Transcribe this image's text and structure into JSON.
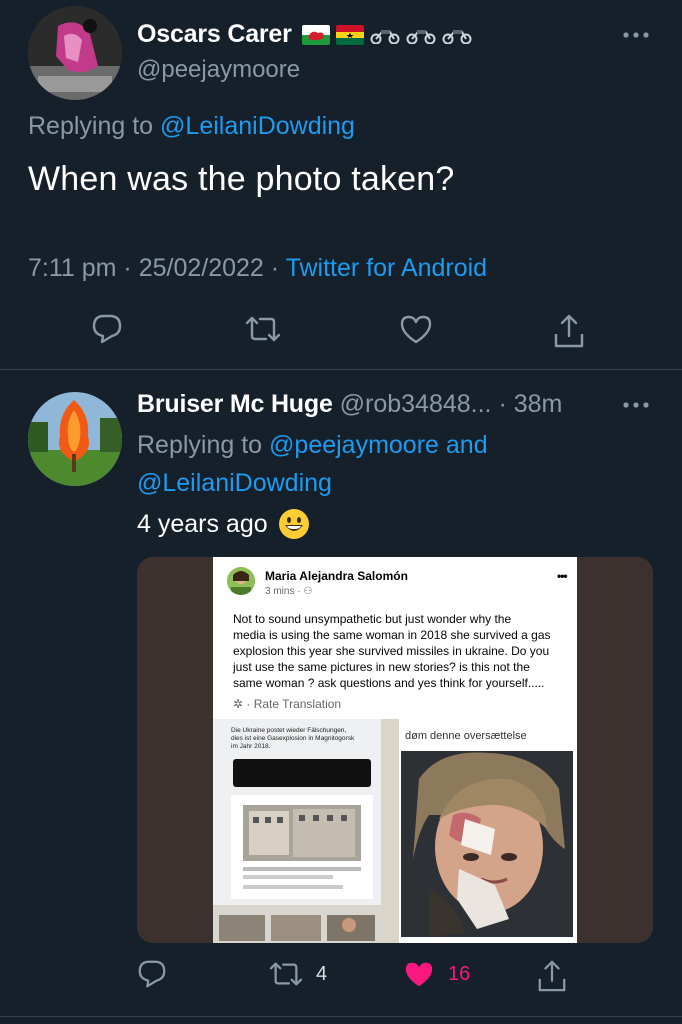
{
  "main_tweet": {
    "display_name": "Oscars Carer",
    "handle": "@peejaymoore",
    "replying_prefix": "Replying to",
    "replying_to": "@LeilaniDowding",
    "text": "When was the photo taken?",
    "time": "7:11 pm · 25/02/2022 ·",
    "source": "Twitter for Android",
    "icons": [
      "wales-flag-icon",
      "ghana-flag-icon",
      "motorcycle-icon",
      "motorcycle-icon",
      "motorcycle-icon"
    ]
  },
  "reply_tweet": {
    "display_name": "Bruiser Mc Huge",
    "handle_time": "@rob34848... · 38m",
    "replying_prefix": "Replying to",
    "replying_to_1": "@peejaymoore",
    "replying_and": "and",
    "replying_to_2": "@LeilaniDowding",
    "text": "4 years ago",
    "retweet_count": "4",
    "like_count": "16",
    "media": {
      "fb_name": "Maria Alejandra Salomón",
      "fb_time": "3 mins · ⚇",
      "fb_more": "•••",
      "fb_text": "Not to sound unsympathetic but just wonder why the\nmedia is using the same woman in 2018 she survived a gas\nexplosion this year she survived missiles in ukraine. Do you\njust use the same pictures in new stories? is this not the\nsame woman ? ask questions and yes think for yourself.....",
      "fb_rate": "✲ · Rate Translation",
      "left_caption": "Die Ukraine postet wieder Fälschungen,\ndies ist eine Gasexplosion in Magnitogorsk\nim Jahr 2018.",
      "right_caption": "døm denne oversættelse"
    }
  },
  "colors": {
    "background": "#15202b",
    "accent": "#1d9bf0",
    "muted": "#8b98a5",
    "like": "#f91880",
    "divider": "#38444d"
  }
}
